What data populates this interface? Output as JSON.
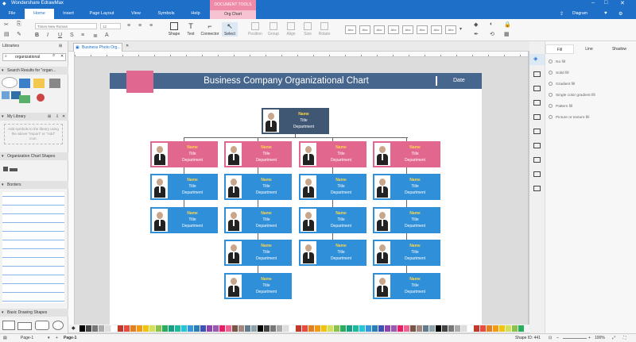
{
  "app": {
    "title": "Wondershare EdrawMax"
  },
  "menu": {
    "items": [
      "File",
      "Home",
      "Insert",
      "Page Layout",
      "View",
      "Symbols",
      "Help"
    ],
    "active": "Home",
    "doc_tools": "DOCUMENT TOOLS",
    "doc_tab": "Org Chart",
    "diagram_label": "Diagram"
  },
  "toolbar": {
    "font": "Times New Roman",
    "size": "12",
    "shape_label": "Shape",
    "text_label": "Text",
    "connector_label": "Connector",
    "select_label": "Select",
    "position_label": "Position",
    "group_label": "Group",
    "align_label": "Align",
    "size_label": "Size",
    "rotate_label": "Rotate",
    "style_box_label": "Abc"
  },
  "left": {
    "libraries": "Libraries",
    "search_value": "organizational",
    "search_results": "Search Results for \"organ...",
    "my_library": "My Library",
    "my_library_hint": "Add symbols to the library using the above \"Import\" or \"Add\" icon.",
    "org_shapes": "Organization Chart Shapes",
    "borders": "Borders",
    "basic_shapes": "Basic Drawing Shapes"
  },
  "doc_tab": "Business Photo Org...",
  "chart": {
    "title": "Business Company Organizational Chart",
    "date": "Date",
    "name_label": "Name",
    "title_label": "Title",
    "department_label": "Department"
  },
  "right": {
    "tabs": [
      "Fill",
      "Line",
      "Shadow"
    ],
    "fill_options": [
      "No fill",
      "Solid fill",
      "Gradient fill",
      "Single color gradient fill",
      "Pattern fill",
      "Picture or texture fill"
    ]
  },
  "status": {
    "page_select": "Page-1",
    "page_tab": "Page-1",
    "shape_id": "Shape ID: 441",
    "zoom": "100%"
  },
  "colors": {
    "accent_blue": "#1e6fc8",
    "header": "#46668e",
    "pink": "#e2678f",
    "card_blue": "#2f8fd8",
    "top_card": "#3f5773"
  }
}
